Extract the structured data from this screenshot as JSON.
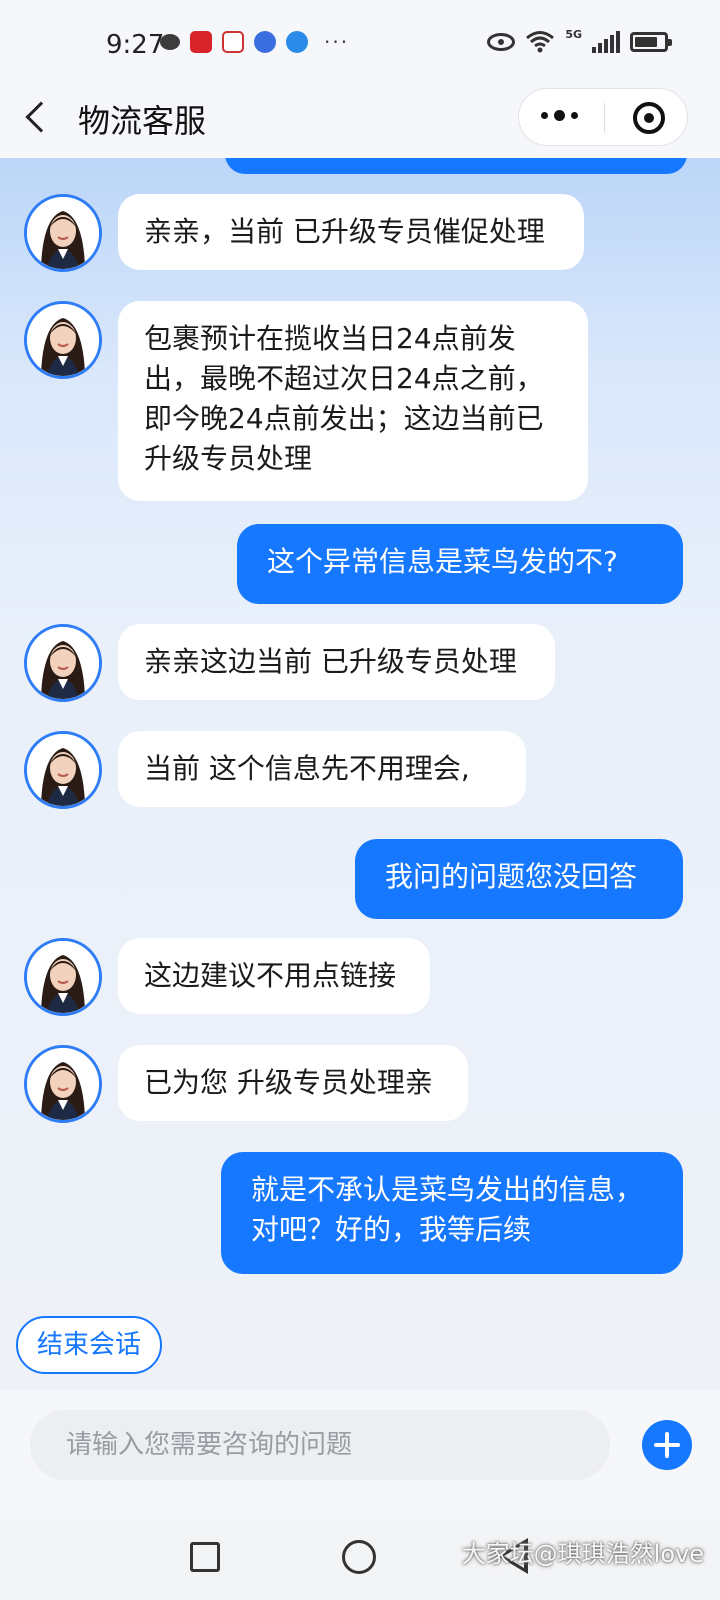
{
  "status_bar": {
    "time": "9:27",
    "network": "5G",
    "left_icons": [
      "wechat-icon",
      "app-icon-red",
      "app-icon-mail",
      "music-icon",
      "browser-icon"
    ],
    "more": "···"
  },
  "header": {
    "title": "物流客服"
  },
  "messages": [
    {
      "side": "left",
      "text": "亲亲，当前 已升级专员催促处理"
    },
    {
      "side": "left",
      "text": "包裹预计在揽收当日24点前发出，最晚不超过次日24点之前，即今晚24点前发出；这边当前已升级专员处理"
    },
    {
      "side": "right",
      "text": "这个异常信息是菜鸟发的不?"
    },
    {
      "side": "left",
      "text": "亲亲这边当前 已升级专员处理"
    },
    {
      "side": "left",
      "text": "当前 这个信息先不用理会,"
    },
    {
      "side": "right",
      "text": "我问的问题您没回答"
    },
    {
      "side": "left",
      "text": "这边建议不用点链接"
    },
    {
      "side": "left",
      "text": "已为您 升级专员处理亲"
    },
    {
      "side": "right",
      "text": "就是不承认是菜鸟发出的信息，对吧？好的，我等后续"
    }
  ],
  "end_button": "结束会话",
  "input": {
    "placeholder": "请输入您需要咨询的问题",
    "value": ""
  },
  "watermark": "大家坛@琪琪浩然love",
  "colors": {
    "accent": "#1677ff",
    "avatar_ring": "#2f7df6",
    "bubble_left": "#ffffff"
  }
}
